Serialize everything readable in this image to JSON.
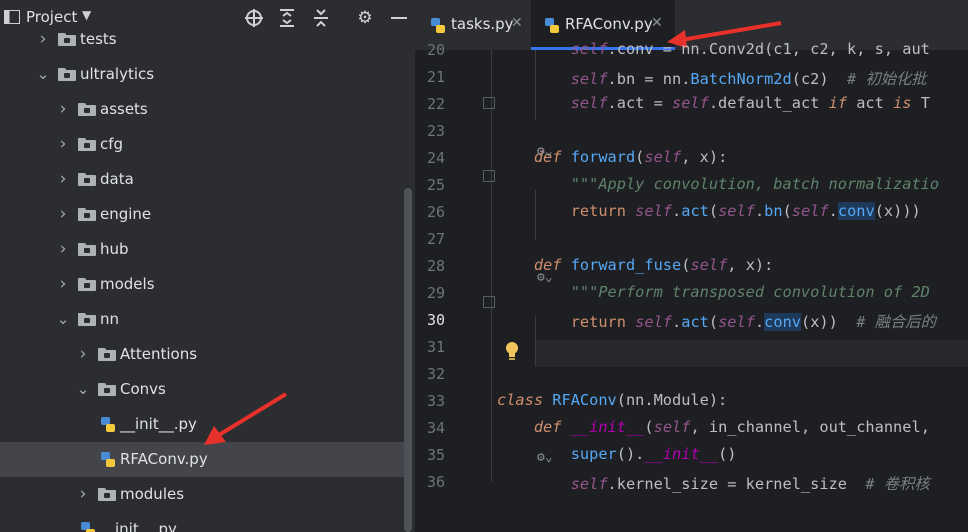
{
  "project_panel": {
    "title": "Project",
    "toolbar_icons": [
      "locate-icon",
      "expand-all-icon",
      "collapse-all-icon",
      "gear-icon",
      "minimize-icon"
    ],
    "tree": [
      {
        "label": "tests",
        "indent": 1,
        "type": "folder",
        "expanded": false,
        "partially_visible": true
      },
      {
        "label": "ultralytics",
        "indent": 1,
        "type": "folder",
        "expanded": true
      },
      {
        "label": "assets",
        "indent": 2,
        "type": "folder",
        "expanded": false
      },
      {
        "label": "cfg",
        "indent": 2,
        "type": "folder",
        "expanded": false
      },
      {
        "label": "data",
        "indent": 2,
        "type": "folder",
        "expanded": false
      },
      {
        "label": "engine",
        "indent": 2,
        "type": "folder",
        "expanded": false
      },
      {
        "label": "hub",
        "indent": 2,
        "type": "folder",
        "expanded": false
      },
      {
        "label": "models",
        "indent": 2,
        "type": "folder",
        "expanded": false
      },
      {
        "label": "nn",
        "indent": 2,
        "type": "folder",
        "expanded": true
      },
      {
        "label": "Attentions",
        "indent": 3,
        "type": "folder",
        "expanded": false
      },
      {
        "label": "Convs",
        "indent": 3,
        "type": "folder",
        "expanded": true
      },
      {
        "label": "__init__.py",
        "indent": 4,
        "type": "py"
      },
      {
        "label": "RFAConv.py",
        "indent": 4,
        "type": "py",
        "selected": true
      },
      {
        "label": "modules",
        "indent": 3,
        "type": "folder",
        "expanded": false
      },
      {
        "label": "__init__.py",
        "indent": 3,
        "type": "py"
      }
    ]
  },
  "editor": {
    "tabs": [
      {
        "label": "tasks.py",
        "active": false
      },
      {
        "label": "RFAConv.py",
        "active": true
      }
    ],
    "current_line": "30",
    "lines": [
      {
        "n": "20",
        "tokens": [
          {
            "t": "        "
          },
          {
            "t": "self",
            "c": "s"
          },
          {
            "t": ".conv = nn.Conv2d(c1, c2, k, s, aut"
          }
        ]
      },
      {
        "n": "21",
        "tokens": [
          {
            "t": "        "
          },
          {
            "t": "self",
            "c": "s"
          },
          {
            "t": ".bn = nn."
          },
          {
            "t": "BatchNorm2d",
            "c": "fn"
          },
          {
            "t": "(c2)  "
          },
          {
            "t": "# 初始化批",
            "c": "cm"
          }
        ]
      },
      {
        "n": "22",
        "tokens": [
          {
            "t": "        "
          },
          {
            "t": "self",
            "c": "s"
          },
          {
            "t": ".act = "
          },
          {
            "t": "self",
            "c": "s"
          },
          {
            "t": ".default_act "
          },
          {
            "t": "if",
            "c": "k"
          },
          {
            "t": " act "
          },
          {
            "t": "is",
            "c": "k"
          },
          {
            "t": " T"
          }
        ]
      },
      {
        "n": "23",
        "tokens": []
      },
      {
        "n": "24",
        "tokens": [
          {
            "t": "    "
          },
          {
            "t": "def",
            "c": "k"
          },
          {
            "t": " "
          },
          {
            "t": "forward",
            "c": "fn"
          },
          {
            "t": "("
          },
          {
            "t": "self",
            "c": "s"
          },
          {
            "t": ", x):"
          }
        ]
      },
      {
        "n": "25",
        "tokens": [
          {
            "t": "        "
          },
          {
            "t": "\"\"\"Apply convolution, batch normalizatio",
            "c": "doc"
          }
        ]
      },
      {
        "n": "26",
        "tokens": [
          {
            "t": "        "
          },
          {
            "t": "return",
            "c": "kw"
          },
          {
            "t": " "
          },
          {
            "t": "self",
            "c": "s"
          },
          {
            "t": "."
          },
          {
            "t": "act",
            "c": "fn"
          },
          {
            "t": "("
          },
          {
            "t": "self",
            "c": "s"
          },
          {
            "t": "."
          },
          {
            "t": "bn",
            "c": "fn"
          },
          {
            "t": "("
          },
          {
            "t": "self",
            "c": "s"
          },
          {
            "t": "."
          },
          {
            "t": "conv",
            "c": "fn hl"
          },
          {
            "t": "(x)))"
          }
        ]
      },
      {
        "n": "27",
        "tokens": []
      },
      {
        "n": "28",
        "tokens": [
          {
            "t": "    "
          },
          {
            "t": "def",
            "c": "k"
          },
          {
            "t": " "
          },
          {
            "t": "forward_fuse",
            "c": "fn"
          },
          {
            "t": "("
          },
          {
            "t": "self",
            "c": "s"
          },
          {
            "t": ", x):"
          }
        ]
      },
      {
        "n": "29",
        "tokens": [
          {
            "t": "        "
          },
          {
            "t": "\"\"\"Perform transposed convolution of 2D",
            "c": "doc"
          }
        ]
      },
      {
        "n": "30",
        "tokens": [
          {
            "t": "        "
          },
          {
            "t": "return",
            "c": "kw"
          },
          {
            "t": " "
          },
          {
            "t": "self",
            "c": "s"
          },
          {
            "t": "."
          },
          {
            "t": "act",
            "c": "fn"
          },
          {
            "t": "("
          },
          {
            "t": "self",
            "c": "s"
          },
          {
            "t": "."
          },
          {
            "t": "conv",
            "c": "fn hl"
          },
          {
            "t": "(x))  "
          },
          {
            "t": "# 融合后的",
            "c": "cm"
          }
        ]
      },
      {
        "n": "31",
        "tokens": []
      },
      {
        "n": "32",
        "tokens": []
      },
      {
        "n": "33",
        "tokens": [
          {
            "t": "class",
            "c": "k"
          },
          {
            "t": " "
          },
          {
            "t": "RFAConv",
            "c": "fn"
          },
          {
            "t": "(nn.Module):"
          }
        ]
      },
      {
        "n": "34",
        "tokens": [
          {
            "t": "    "
          },
          {
            "t": "def",
            "c": "k"
          },
          {
            "t": " "
          },
          {
            "t": "__init__",
            "c": "magic"
          },
          {
            "t": "("
          },
          {
            "t": "self",
            "c": "s"
          },
          {
            "t": ", in_channel, out_channel,"
          }
        ]
      },
      {
        "n": "35",
        "tokens": [
          {
            "t": "        "
          },
          {
            "t": "super",
            "c": "fn"
          },
          {
            "t": "()."
          },
          {
            "t": "__init__",
            "c": "magic"
          },
          {
            "t": "()"
          }
        ]
      },
      {
        "n": "36",
        "tokens": [
          {
            "t": "        "
          },
          {
            "t": "self",
            "c": "s"
          },
          {
            "t": ".kernel_size = kernel_size  "
          },
          {
            "t": "# 卷积核",
            "c": "cm"
          }
        ]
      }
    ],
    "colors": {
      "keyword": "#cf8e6d",
      "self": "#94558d",
      "function": "#56a8f5",
      "comment": "#7a7e85",
      "docstring": "#5f826b",
      "accent": "#3574f0",
      "arrow": "#e8312a"
    }
  }
}
